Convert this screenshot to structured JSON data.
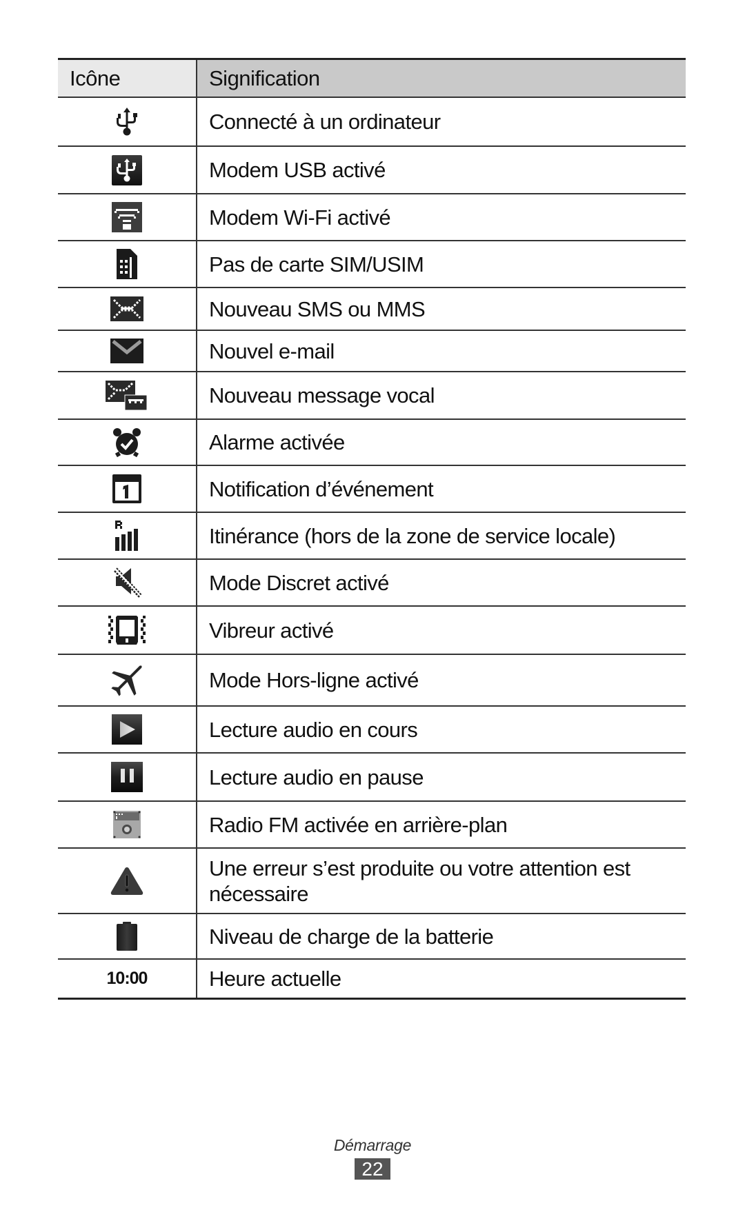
{
  "table": {
    "headers": {
      "icon": "Icône",
      "meaning": "Signification"
    },
    "rows": [
      {
        "icon": "usb-connected-icon",
        "meaning": "Connecté à un ordinateur"
      },
      {
        "icon": "usb-tethering-icon",
        "meaning": "Modem USB activé"
      },
      {
        "icon": "wifi-hotspot-icon",
        "meaning": "Modem Wi-Fi activé"
      },
      {
        "icon": "no-sim-icon",
        "meaning": "Pas de carte SIM/USIM"
      },
      {
        "icon": "sms-mms-icon",
        "meaning": "Nouveau SMS ou MMS"
      },
      {
        "icon": "email-icon",
        "meaning": "Nouvel e-mail"
      },
      {
        "icon": "voicemail-icon",
        "meaning": "Nouveau message vocal"
      },
      {
        "icon": "alarm-icon",
        "meaning": "Alarme activée"
      },
      {
        "icon": "calendar-event-icon",
        "meaning": "Notification d’événement"
      },
      {
        "icon": "roaming-icon",
        "meaning": "Itinérance (hors de la zone de service locale)"
      },
      {
        "icon": "silent-mode-icon",
        "meaning": "Mode Discret activé"
      },
      {
        "icon": "vibrate-icon",
        "meaning": "Vibreur activé"
      },
      {
        "icon": "airplane-mode-icon",
        "meaning": "Mode Hors-ligne activé"
      },
      {
        "icon": "play-icon",
        "meaning": "Lecture audio en cours"
      },
      {
        "icon": "pause-icon",
        "meaning": "Lecture audio en pause"
      },
      {
        "icon": "fm-radio-icon",
        "meaning": "Radio FM activée en arrière-plan"
      },
      {
        "icon": "warning-icon",
        "meaning": "Une erreur s’est produite ou votre attention est nécessaire"
      },
      {
        "icon": "battery-icon",
        "meaning": "Niveau de charge de la batterie"
      },
      {
        "icon": "time-display",
        "icon_text": "10:00",
        "meaning": "Heure actuelle"
      }
    ]
  },
  "footer": {
    "section": "Démarrage",
    "page_number": "22"
  }
}
